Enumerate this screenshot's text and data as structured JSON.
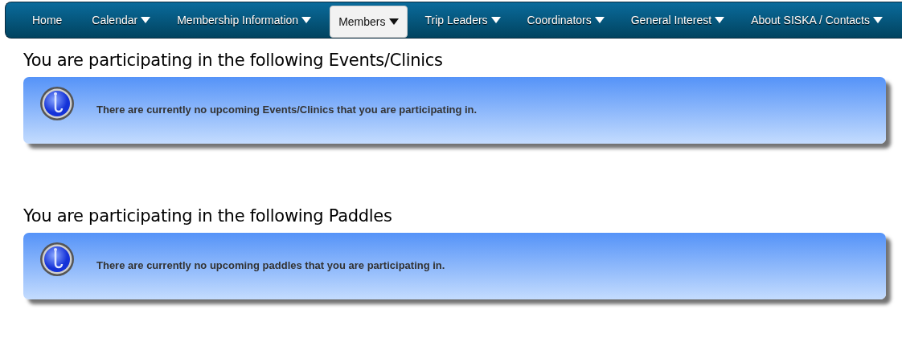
{
  "nav": {
    "items": [
      {
        "label": "Home",
        "has_menu": false,
        "selected": false
      },
      {
        "label": "Calendar",
        "has_menu": true,
        "selected": false
      },
      {
        "label": "Membership Information",
        "has_menu": true,
        "selected": false
      },
      {
        "label": "Members",
        "has_menu": true,
        "selected": true
      },
      {
        "label": "Trip Leaders",
        "has_menu": true,
        "selected": false
      },
      {
        "label": "Coordinators",
        "has_menu": true,
        "selected": false
      },
      {
        "label": "General Interest",
        "has_menu": true,
        "selected": false
      },
      {
        "label": "About SISKA / Contacts",
        "has_menu": true,
        "selected": false
      }
    ]
  },
  "sections": [
    {
      "heading": "You are participating in the following Events/Clinics",
      "message": "There are currently no upcoming Events/Clinics that you are participating in."
    },
    {
      "heading": "You are participating in the following Paddles",
      "message": "There are currently no upcoming paddles that you are participating in."
    }
  ]
}
